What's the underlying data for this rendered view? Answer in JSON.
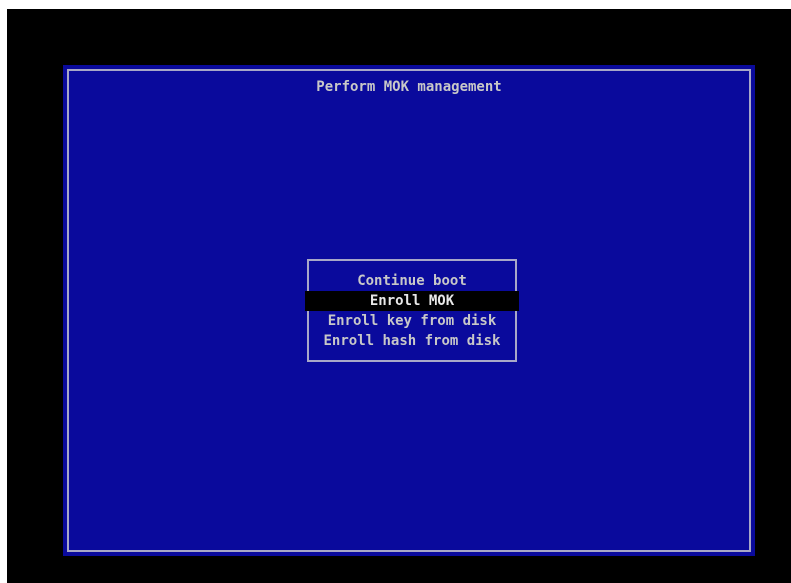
{
  "window": {
    "title": "Perform MOK management"
  },
  "menu": {
    "selected_index": 1,
    "items": [
      {
        "label": "Continue boot"
      },
      {
        "label": "Enroll MOK"
      },
      {
        "label": "Enroll key from disk"
      },
      {
        "label": "Enroll hash from disk"
      }
    ]
  },
  "colors": {
    "background": "#0a0a9c",
    "text": "#c8c8c8",
    "frame": "#a8a8c8",
    "selection": "#000000"
  }
}
